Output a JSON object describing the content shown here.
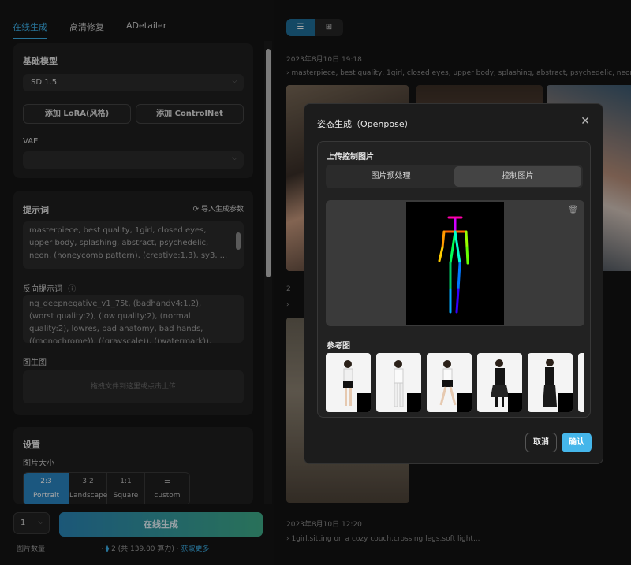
{
  "tabs": [
    "在线生成",
    "高清修复",
    "ADetailer"
  ],
  "base_model": {
    "title": "基础模型",
    "value": "SD 1.5"
  },
  "buttons": {
    "add_lora": "添加 LoRA(风格)",
    "add_controlnet": "添加 ControlNet"
  },
  "vae": {
    "label": "VAE",
    "value": ""
  },
  "prompt": {
    "title": "提示词",
    "import_label": "导入生成参数",
    "text": "masterpiece, best quality, 1girl, closed eyes, upper body, splashing, abstract, psychedelic, neon, (honeycomb pattern), (creative:1.3), sy3, ..."
  },
  "negative": {
    "label": "反向提示词",
    "text": "ng_deepnegative_v1_75t, (badhandv4:1.2), (worst quality:2), (low quality:2), (normal quality:2), lowres, bad anatomy, bad hands, ((monochrome)), ((grayscale)), ((watermark)), nude, naked"
  },
  "img2img": {
    "label": "图生图",
    "dropzone": "拖拽文件到这里或点击上传"
  },
  "settings": {
    "title": "设置",
    "size_label": "图片大小",
    "sizes": [
      {
        "label": "Portrait",
        "icon": "2:3",
        "active": true
      },
      {
        "label": "Landscape",
        "icon": "3:2",
        "active": false
      },
      {
        "label": "Square",
        "icon": "1:1",
        "active": false
      },
      {
        "label": "custom",
        "icon": "sliders-icon",
        "active": false
      }
    ]
  },
  "footer": {
    "count_value": "1",
    "generate_label": "在线生成",
    "count_label": "图片数量",
    "credits": "2",
    "credits_total": "(共 139.00 算力)",
    "get_more": "获取更多"
  },
  "history": [
    {
      "date": "2023年8月10日 19:18",
      "prompt": "masterpiece, best quality, 1girl, closed eyes, upper body, splashing, abstract, psychedelic, neon, (hon"
    },
    {
      "date": "2023年8月10日 12:20",
      "prompt": "1girl,sitting on a cozy couch,crossing legs,soft light..."
    }
  ],
  "modal": {
    "title": "姿态生成（Openpose）",
    "section_title": "上传控制图片",
    "seg_options": [
      "图片预处理",
      "控制图片"
    ],
    "seg_active": 1,
    "ref_title": "参考图",
    "cancel": "取消",
    "confirm": "确认"
  },
  "colors": {
    "accent": "#3db0e8",
    "confirm": "#45b6ea",
    "generate_start": "#2a86b8",
    "generate_end": "#3fae8a"
  }
}
